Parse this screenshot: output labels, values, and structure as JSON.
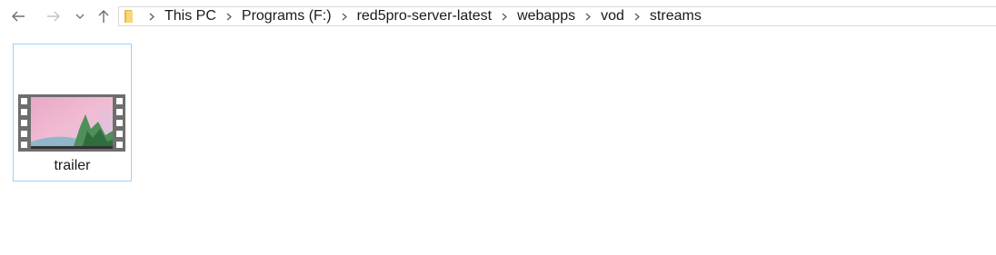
{
  "navigation": {
    "back_icon": "arrow-left-icon",
    "forward_icon": "arrow-right-icon",
    "recent_icon": "chevron-down-icon",
    "up_icon": "arrow-up-icon"
  },
  "address_bar": {
    "location_icon": "folder-icon",
    "breadcrumbs": [
      "This PC",
      "Programs (F:)",
      "red5pro-server-latest",
      "webapps",
      "vod",
      "streams"
    ]
  },
  "files": [
    {
      "name": "trailer",
      "icon": "video-file-thumbnail-icon"
    }
  ],
  "colors": {
    "selection_border": "#99d1ff",
    "text": "#1a1a1a",
    "address_border": "#d9d9d9"
  }
}
